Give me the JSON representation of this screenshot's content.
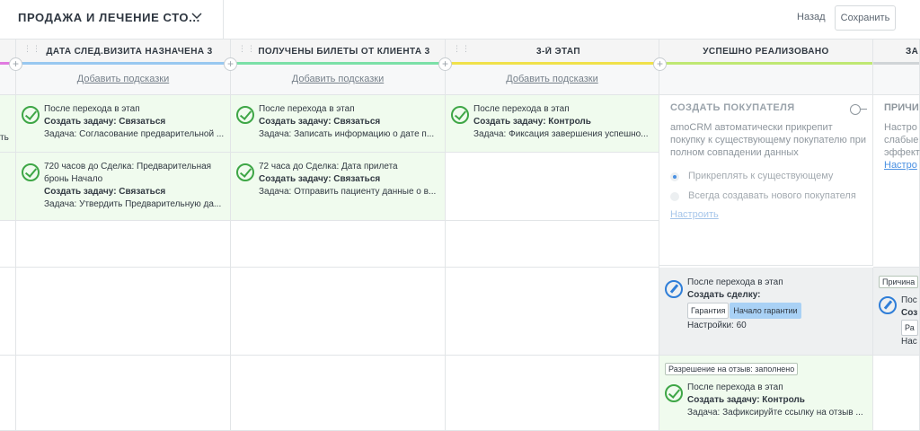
{
  "header": {
    "title": "ПРОДАЖА И ЛЕЧЕНИЕ СТО...",
    "back_label": "Назад",
    "save_label": "Сохранить"
  },
  "columns": [
    {
      "name": "",
      "color": "#e07ae0"
    },
    {
      "name": "ДАТА СЛЕД.ВИЗИТА НАЗНАЧЕНА 3",
      "color": "#98c8f0"
    },
    {
      "name": "ПОЛУЧЕНЫ БИЛЕТЫ ОТ КЛИЕНТА 3",
      "color": "#7be0a8"
    },
    {
      "name": "3-Й ЭТАП",
      "color": "#f0e14a"
    },
    {
      "name": "УСПЕШНО РЕАЛИЗОВАНО",
      "color": "#bfe873"
    },
    {
      "name": "ЗА",
      "color": "#d0d4d7"
    }
  ],
  "hint_label": "Добавить подсказки",
  "rows": {
    "row1": [
      {
        "t1": "После перехода в этап",
        "bold": "Создать задачу: Связаться",
        "t3": "Задача: Согласование предварительной ..."
      },
      {
        "t1": "После перехода в этап",
        "bold": "Создать задачу: Связаться",
        "t3": "Задача: Записать информацию о дате п..."
      },
      {
        "t1": "После перехода в этап",
        "bold": "Создать задачу: Контроль",
        "t3": "Задача: Фиксация завершения успешно..."
      }
    ],
    "row2": [
      {
        "t1": "720 часов до Сделка: Предварительная",
        "t1b": "бронь Начало",
        "bold": "Создать задачу: Связаться",
        "t3": "Задача: Утвердить Предварительную да..."
      },
      {
        "t1": "72 часа до Сделка: Дата прилета",
        "bold": "Создать задачу: Связаться",
        "t3": "Задача: Отправить пациенту данные о в..."
      }
    ]
  },
  "buyer": {
    "title": "СОЗДАТЬ ПОКУПАТЕЛЯ",
    "description": "amoCRM автоматически прикрепит покупку к существующему покупателю при полном совпадении данных",
    "option1": "Прикреплять к существующему",
    "option2": "Всегда создавать нового покупателя",
    "configure": "Настроить"
  },
  "deal": {
    "t1": "После перехода в этап",
    "bold": "Создать сделку:",
    "tag1": "Гарантия",
    "tag2": "Начало гарантии",
    "settings": "Настройки: 60"
  },
  "review": {
    "chip": "Разрешение на отзыв: заполнено",
    "t1": "После перехода в этап",
    "bold": "Создать задачу: Контроль",
    "t3": "Задача: Зафиксируйте ссылку на отзыв ..."
  },
  "edge_right": {
    "r1_title": "ПРИЧИ",
    "r1_l1": "Настро",
    "r1_l2": "слабые",
    "r1_l3": "эффект",
    "r1_link": "Настро",
    "r4_chip": "Причина",
    "r4_l1": "Пос",
    "r4_l2": "Соз",
    "r4_tag": "Ра",
    "r4_l3": "Нас"
  },
  "edge_left": {
    "a": "ть",
    "b": "..."
  }
}
